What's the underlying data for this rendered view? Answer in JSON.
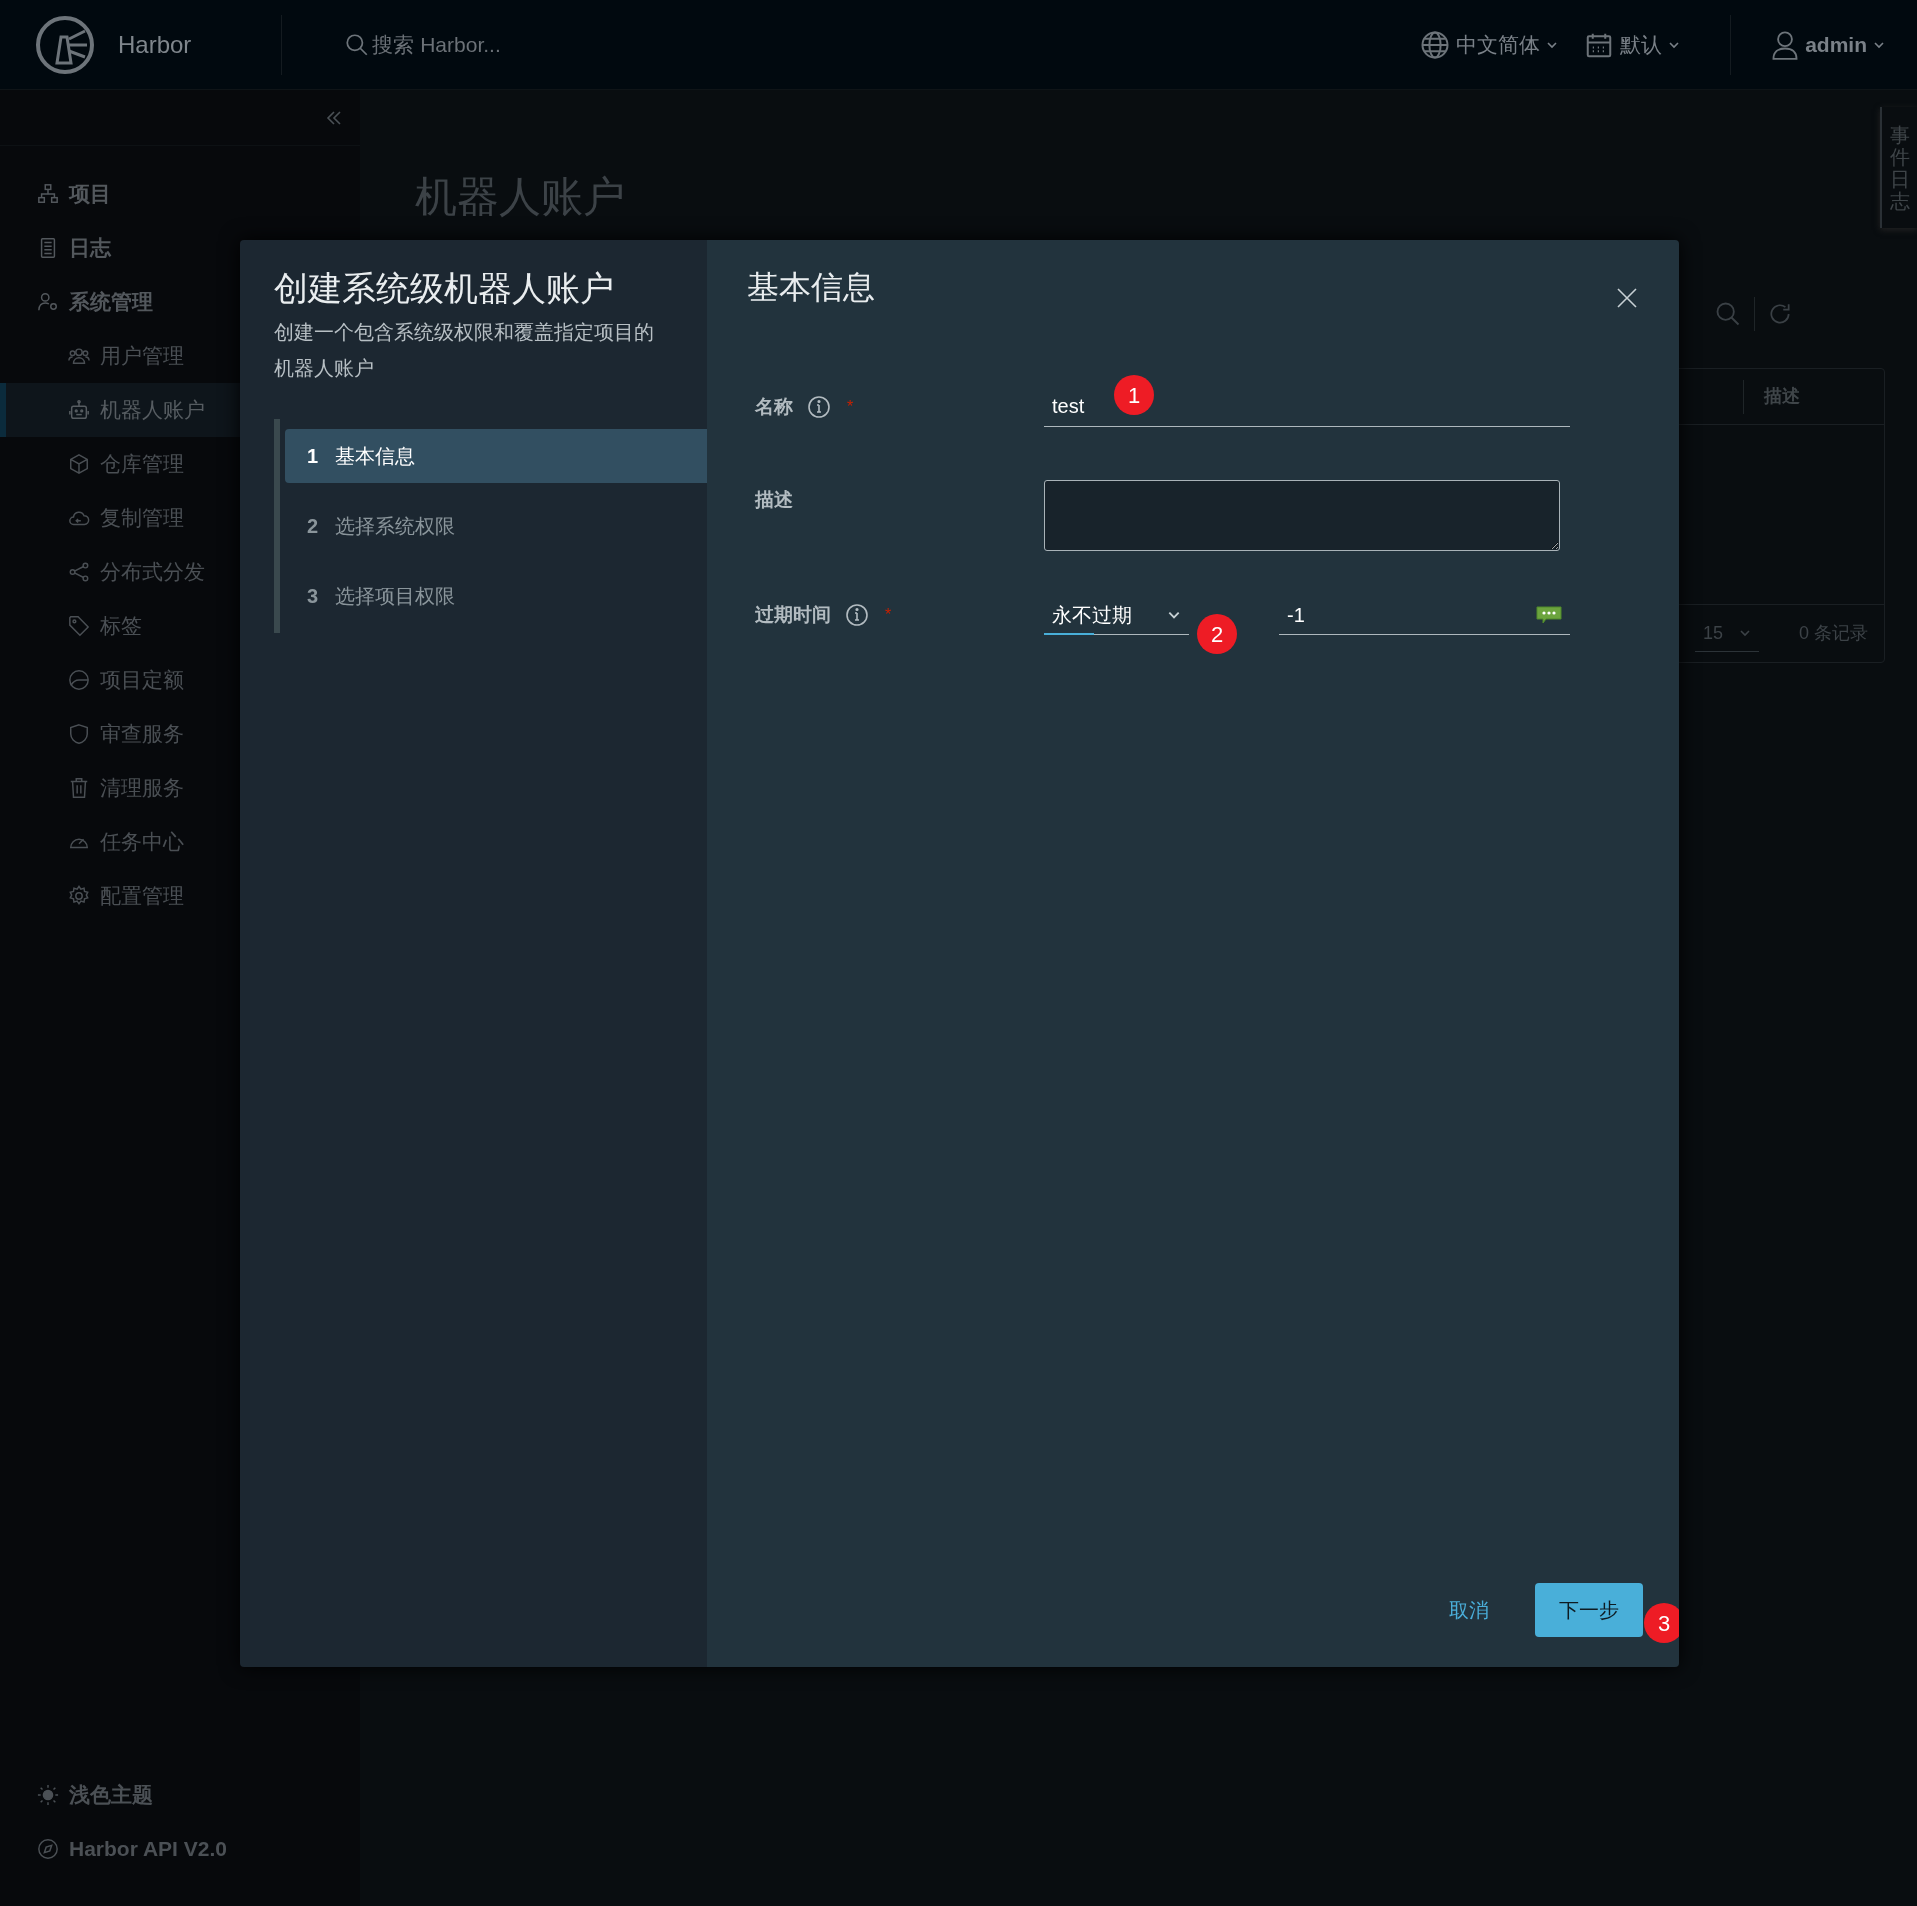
{
  "header": {
    "brand": "Harbor",
    "search": {
      "placeholder": "搜索 Harbor..."
    },
    "language": "中文简体",
    "date_format": "默认",
    "user": "admin"
  },
  "sidebar": {
    "items": [
      {
        "label": "项目",
        "selected": false
      },
      {
        "label": "日志",
        "selected": false
      },
      {
        "label": "系统管理",
        "selected": false,
        "children": [
          {
            "label": "用户管理",
            "selected": false
          },
          {
            "label": "机器人账户",
            "selected": true
          },
          {
            "label": "仓库管理",
            "selected": false
          },
          {
            "label": "复制管理",
            "selected": false
          },
          {
            "label": "分布式分发",
            "selected": false
          },
          {
            "label": "标签",
            "selected": false
          },
          {
            "label": "项目定额",
            "selected": false
          },
          {
            "label": "审查服务",
            "selected": false
          },
          {
            "label": "清理服务",
            "selected": false
          },
          {
            "label": "任务中心",
            "selected": false
          },
          {
            "label": "配置管理",
            "selected": false
          }
        ]
      }
    ],
    "footer": [
      "浅色主题",
      "Harbor API V2.0"
    ]
  },
  "page": {
    "title": "机器人账户",
    "table": {
      "columns": [
        "描述"
      ],
      "page_size": "15",
      "total": "0 条记录"
    }
  },
  "event_log_tab": "事件日志",
  "dialog": {
    "title": "创建系统级机器人账户",
    "subtitle": "创建一个包含系统级权限和覆盖指定项目的机器人账户",
    "steps": [
      {
        "number": "1",
        "label": "基本信息",
        "selected": true
      },
      {
        "number": "2",
        "label": "选择系统权限",
        "selected": false
      },
      {
        "number": "3",
        "label": "选择项目权限",
        "selected": false
      }
    ],
    "section_title": "基本信息",
    "fields": [
      {
        "kind": "text",
        "label": "名称",
        "info": true,
        "required_mark": "*",
        "value": "test"
      },
      {
        "kind": "textarea",
        "label": "描述",
        "info": false
      },
      {
        "kind": "expiry",
        "label": "过期时间",
        "info": true,
        "required_mark": "*",
        "select": "永不过期",
        "value": "-1"
      }
    ],
    "buttons": [
      {
        "kind": "link",
        "label": "取消"
      },
      {
        "kind": "primary",
        "label": "下一步"
      }
    ]
  },
  "annotations": [
    {
      "text": "1"
    },
    {
      "text": "2"
    },
    {
      "text": "3"
    }
  ]
}
